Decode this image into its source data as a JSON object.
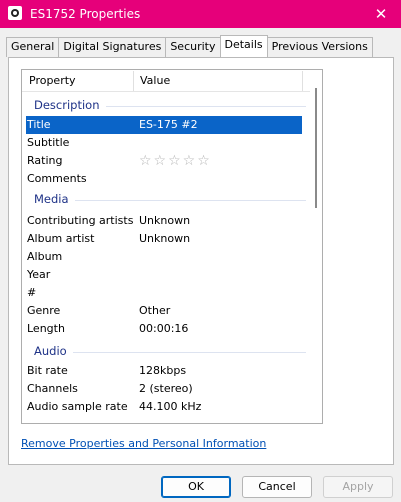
{
  "window": {
    "title": "ES1752 Properties",
    "close_glyph": "✕",
    "accent_color": "#e6007a"
  },
  "tabs": [
    {
      "label": "General"
    },
    {
      "label": "Digital Signatures"
    },
    {
      "label": "Security"
    },
    {
      "label": "Details",
      "active": true
    },
    {
      "label": "Previous Versions"
    }
  ],
  "list": {
    "columns": {
      "property": "Property",
      "value": "Value"
    },
    "groups": {
      "description": "Description",
      "media": "Media",
      "audio": "Audio"
    },
    "rows": {
      "title": {
        "name": "Title",
        "value": "ES-175 #2"
      },
      "subtitle": {
        "name": "Subtitle",
        "value": ""
      },
      "rating": {
        "name": "Rating",
        "stars": "☆☆☆☆☆",
        "rating_value": 0
      },
      "comments": {
        "name": "Comments",
        "value": ""
      },
      "contributing_artists": {
        "name": "Contributing artists",
        "value": "Unknown"
      },
      "album_artist": {
        "name": "Album artist",
        "value": "Unknown"
      },
      "album": {
        "name": "Album",
        "value": ""
      },
      "year": {
        "name": "Year",
        "value": ""
      },
      "track": {
        "name": "#",
        "value": ""
      },
      "genre": {
        "name": "Genre",
        "value": "Other"
      },
      "length": {
        "name": "Length",
        "value": "00:00:16"
      },
      "bit_rate": {
        "name": "Bit rate",
        "value": "128kbps"
      },
      "channels": {
        "name": "Channels",
        "value": "2 (stereo)"
      },
      "sample_rate": {
        "name": "Audio sample rate",
        "value": "44.100 kHz"
      }
    }
  },
  "link": {
    "remove": "Remove Properties and Personal Information"
  },
  "buttons": {
    "ok": "OK",
    "cancel": "Cancel",
    "apply": "Apply"
  }
}
